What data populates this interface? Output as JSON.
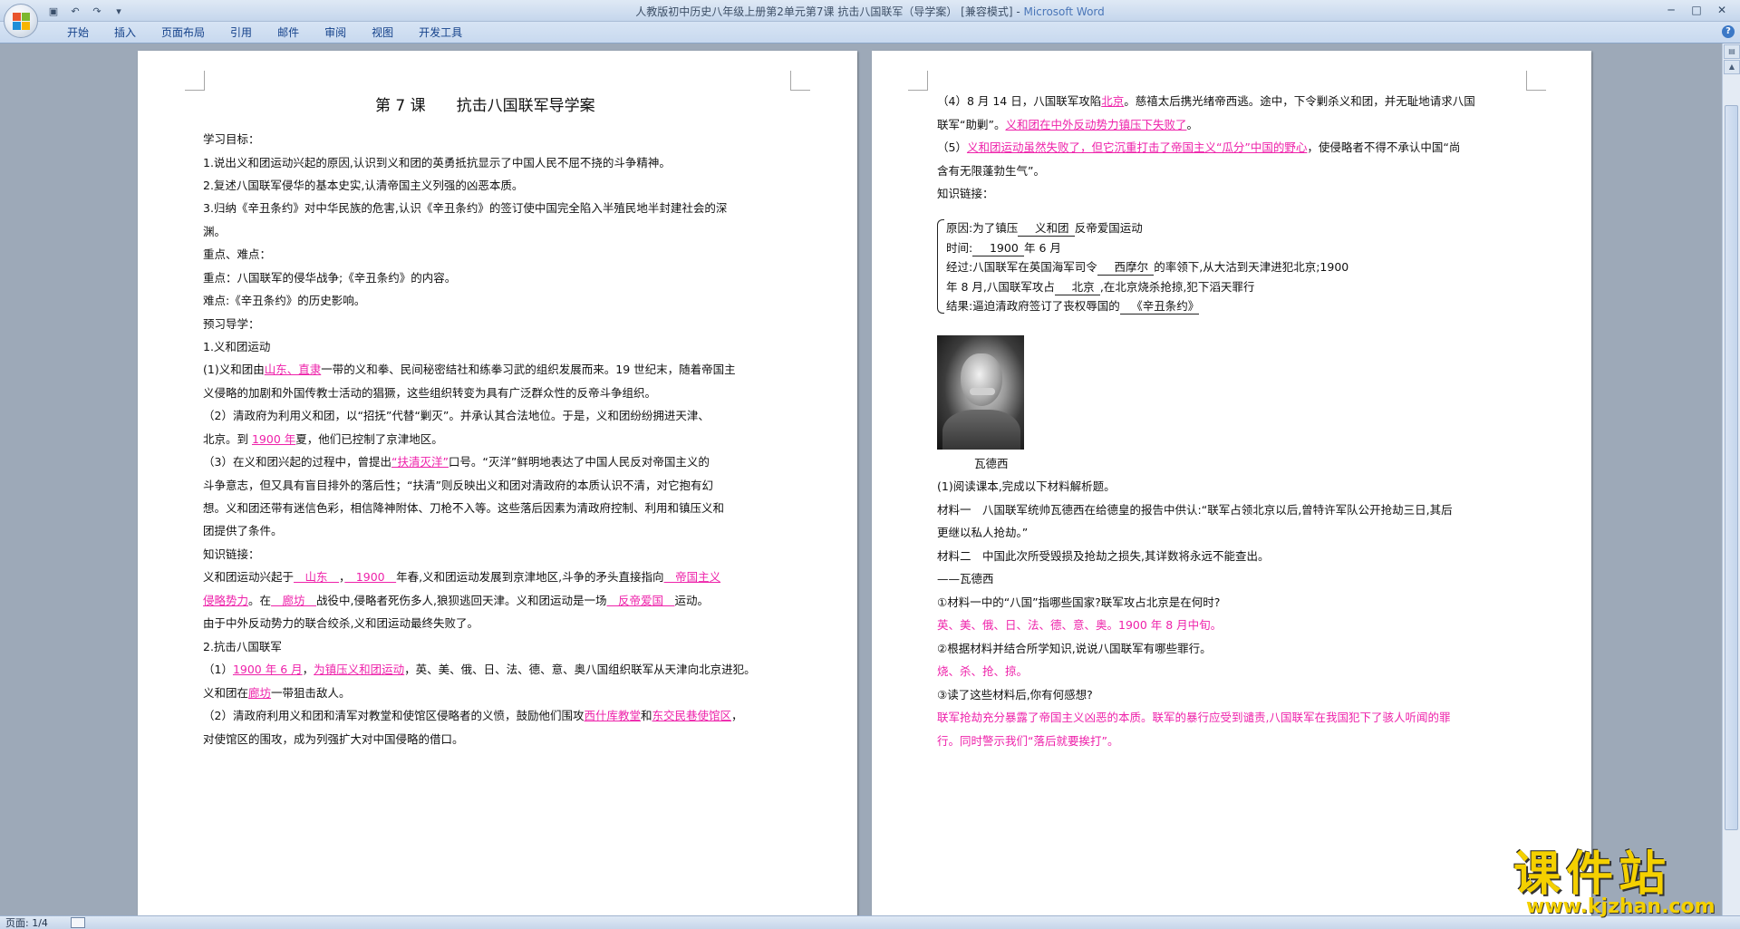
{
  "window": {
    "title": "人教版初中历史八年级上册第2单元第7课 抗击八国联军（导学案） [兼容模式]",
    "app_name": "Microsoft Word",
    "qat": {
      "save": "保存",
      "undo": "撤销",
      "redo": "恢复"
    },
    "controls": {
      "minimize": "─",
      "maximize": "□",
      "close": "✕"
    }
  },
  "ribbon": {
    "tabs": [
      "开始",
      "插入",
      "页面布局",
      "引用",
      "邮件",
      "审阅",
      "视图",
      "开发工具"
    ],
    "help": "?"
  },
  "page1": {
    "title": "第 7 课　　抗击八国联军导学案",
    "objectives_heading": "学习目标：",
    "obj1": "1.说出义和团运动兴起的原因,认识到义和团的英勇抵抗显示了中国人民不屈不挠的斗争精神。",
    "obj2": "2.复述八国联军侵华的基本史实,认清帝国主义列强的凶恶本质。",
    "obj3a": "3.归纳《辛丑条约》对中华民族的危害,认识《辛丑条约》的签订使中国完全陷入半殖民地半封建社会的深",
    "obj3b": "渊。",
    "key_heading": "重点、难点：",
    "key": "重点：八国联军的侵华战争;《辛丑条约》的内容。",
    "difficult": "难点:《辛丑条约》的历史影响。",
    "preview_heading": "预习导学：",
    "sec1": "1.义和团运动",
    "p1a_pre": "(1)义和团由",
    "p1a_ans": "山东、直隶",
    "p1a_post": "一带的义和拳、民间秘密结社和练拳习武的组织发展而来。19 世纪末，随着帝国主",
    "p1b": "义侵略的加剧和外国传教士活动的猖獗，这些组织转变为具有广泛群众性的反帝斗争组织。",
    "p2a": "（2）清政府为利用义和团，以“招抚”代替“剿灭”。并承认其合法地位。于是，义和团纷纷拥进天津、",
    "p2b_pre": "北京。到 ",
    "p2b_ans": "1900 年",
    "p2b_post": "夏，他们已控制了京津地区。",
    "p3a_pre": "（3）在义和团兴起的过程中，曾提出",
    "p3a_ans": "“扶清灭洋”",
    "p3a_post": "口号。“灭洋”鲜明地表达了中国人民反对帝国主义的",
    "p3b": "斗争意志，但又具有盲目排外的落后性；“扶清”则反映出义和团对清政府的本质认识不清，对它抱有幻",
    "p3c": "想。义和团还带有迷信色彩，相信降神附体、刀枪不入等。这些落后因素为清政府控制、利用和镇压义和",
    "p3d": "团提供了条件。",
    "link_heading": "知识链接：",
    "link1_a": "义和团运动兴起于",
    "link1_ans1": "　山东　",
    "link1_b": "，",
    "link1_ans2": "　1900　",
    "link1_c": "年春,义和团运动发展到京津地区,斗争的矛头直接指向",
    "link1_ans3": "　帝国主义",
    "link2_ans3b": "侵略势力",
    "link2_a": "。在",
    "link2_ans4": "　廊坊　",
    "link2_b": "战役中,侵略者死伤多人,狼狈逃回天津。义和团运动是一场",
    "link2_ans5": "　反帝爱国　",
    "link2_c": "运动。",
    "link3": "由于中外反动势力的联合绞杀,义和团运动最终失败了。",
    "sec2": "2.抗击八国联军",
    "q1a_pre": "（1）",
    "q1a_ans1": "1900 年 6 月",
    "q1a_mid": "，",
    "q1a_ans2": "为镇压义和团运动",
    "q1a_post": "，英、美、俄、日、法、德、意、奥八国组织联军从天津向北京进犯。",
    "q1b_pre": "义和团在",
    "q1b_ans": "廊坊",
    "q1b_post": "一带狙击敌人。",
    "q2a_pre": "（2）清政府利用义和团和清军对教堂和使馆区侵略者的义愤，鼓励他们围攻",
    "q2a_ans1": "西什库教堂",
    "q2a_mid": "和",
    "q2a_ans2": "东交民巷使馆区",
    "q2a_post": "，",
    "q2b": "对使馆区的围攻，成为列强扩大对中国侵略的借口。"
  },
  "page2": {
    "q4a_pre": "（4）8 月 14 日，八国联军攻陷",
    "q4a_ans": "北京",
    "q4a_post": "。慈禧太后携光绪帝西逃。途中，下令剿杀义和团，并无耻地请求八国",
    "q4b_pre": "联军“助剿”。",
    "q4b_ans": "义和团在中外反动势力镇压下失败了",
    "q4b_post": "。",
    "q5a_pre": "（5）",
    "q5a_ans": "义和团运动虽然失败了，但它沉重打击了帝国主义“瓜分”中国的野心",
    "q5a_post": "，使侵略者不得不承认中国“尚",
    "q5b": "含有无限蓬勃生气”。",
    "link_heading": "知识链接：",
    "b1_pre": "原因:为了镇压",
    "b1_ans": "　义和团　",
    "b1_post": "反帝爱国运动",
    "b2_pre": "时间:",
    "b2_ans": "　1900　",
    "b2_post": "年 6 月",
    "b3_pre": "经过:八国联军在英国海军司令",
    "b3_ans": "　西摩尔　",
    "b3_post": "的率领下,从大沽到天津进犯北京;1900",
    "b4_pre": "年 8 月,八国联军攻占",
    "b4_ans": "　北京　",
    "b4_post": ",在北京烧杀抢掠,犯下滔天罪行",
    "b5_pre": "结果:逼迫清政府签订了丧权辱国的",
    "b5_ans": "　《辛丑条约》　",
    "photo_caption": "瓦德西",
    "read_heading": "(1)阅读课本,完成以下材料解析题。",
    "m1a": "材料一　八国联军统帅瓦德西在给德皇的报告中供认:“联军占领北京以后,曾特许军队公开抢劫三日,其后",
    "m1b": "更继以私人抢劫。”",
    "m2": "材料二　中国此次所受毁损及抢劫之损失,其详数将永远不能查出。",
    "m3": "——瓦德西",
    "qa1": "①材料一中的“八国”指哪些国家?联军攻占北京是在何时?",
    "aa1": "英、美、俄、日、法、德、意、奥。1900 年 8 月中旬。",
    "qa2": "②根据材料并结合所学知识,说说八国联军有哪些罪行。",
    "aa2": "烧、杀、抢、掠。",
    "qa3": "③读了这些材料后,你有何感想?",
    "aa3a": "联军抢劫充分暴露了帝国主义凶恶的本质。联军的暴行应受到谴责,八国联军在我国犯下了骇人听闻的罪",
    "aa3b": "行。同时警示我们“落后就要挨打”。"
  },
  "status": {
    "page": "页面: 1/4"
  },
  "watermark": {
    "name": "课件站",
    "url": "www.kjzhan.com"
  },
  "colors": {
    "answer": "#ee22aa",
    "ribbon_text": "#15428b",
    "watermark": "#f4d000"
  }
}
